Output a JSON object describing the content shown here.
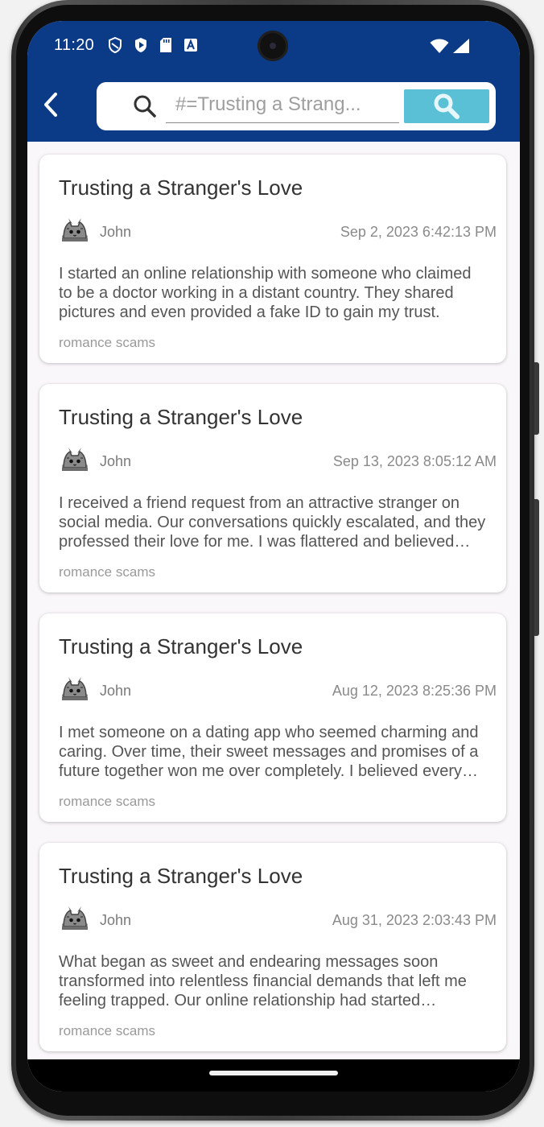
{
  "status_bar": {
    "time": "11:20",
    "left_icons": [
      "shield-icon",
      "play-protect-icon",
      "sd-card-icon",
      "a-badge-icon"
    ],
    "right_icons": [
      "wifi-icon",
      "signal-icon"
    ]
  },
  "header": {
    "background_color": "#0b3a86",
    "search": {
      "value": "#=Trusting a Strang...",
      "full_value": "#=Trusting a Stranger's Love"
    },
    "search_button_color": "#5ac0d6"
  },
  "posts": [
    {
      "title": "Trusting a Stranger's Love",
      "author": "John",
      "date": "Sep 2, 2023 6:42:13 PM",
      "excerpt": "I started an online relationship with someone who claimed to be a doctor working in a distant country. They shared pictures and even provided a fake ID to gain my trust.",
      "tag": "romance scams"
    },
    {
      "title": "Trusting a Stranger's Love",
      "author": "John",
      "date": "Sep 13, 2023 8:05:12 AM",
      "excerpt": "I received a friend request from an attractive stranger on social media. Our conversations quickly escalated, and they professed their love for me. I was flattered and believed them.",
      "tag": "romance scams"
    },
    {
      "title": "Trusting a Stranger's Love",
      "author": "John",
      "date": "Aug 12, 2023 8:25:36 PM",
      "excerpt": "I met someone on a dating app who seemed charming and caring. Over time, their sweet messages and promises of a future together won me over completely. I believed every word.",
      "tag": "romance scams"
    },
    {
      "title": "Trusting a Stranger's Love",
      "author": "John",
      "date": "Aug 31, 2023 2:03:43 PM",
      "excerpt": "What began as sweet and endearing messages soon transformed into relentless financial demands that left me feeling trapped. Our online relationship had started innocently enough.",
      "tag": "romance scams"
    }
  ]
}
